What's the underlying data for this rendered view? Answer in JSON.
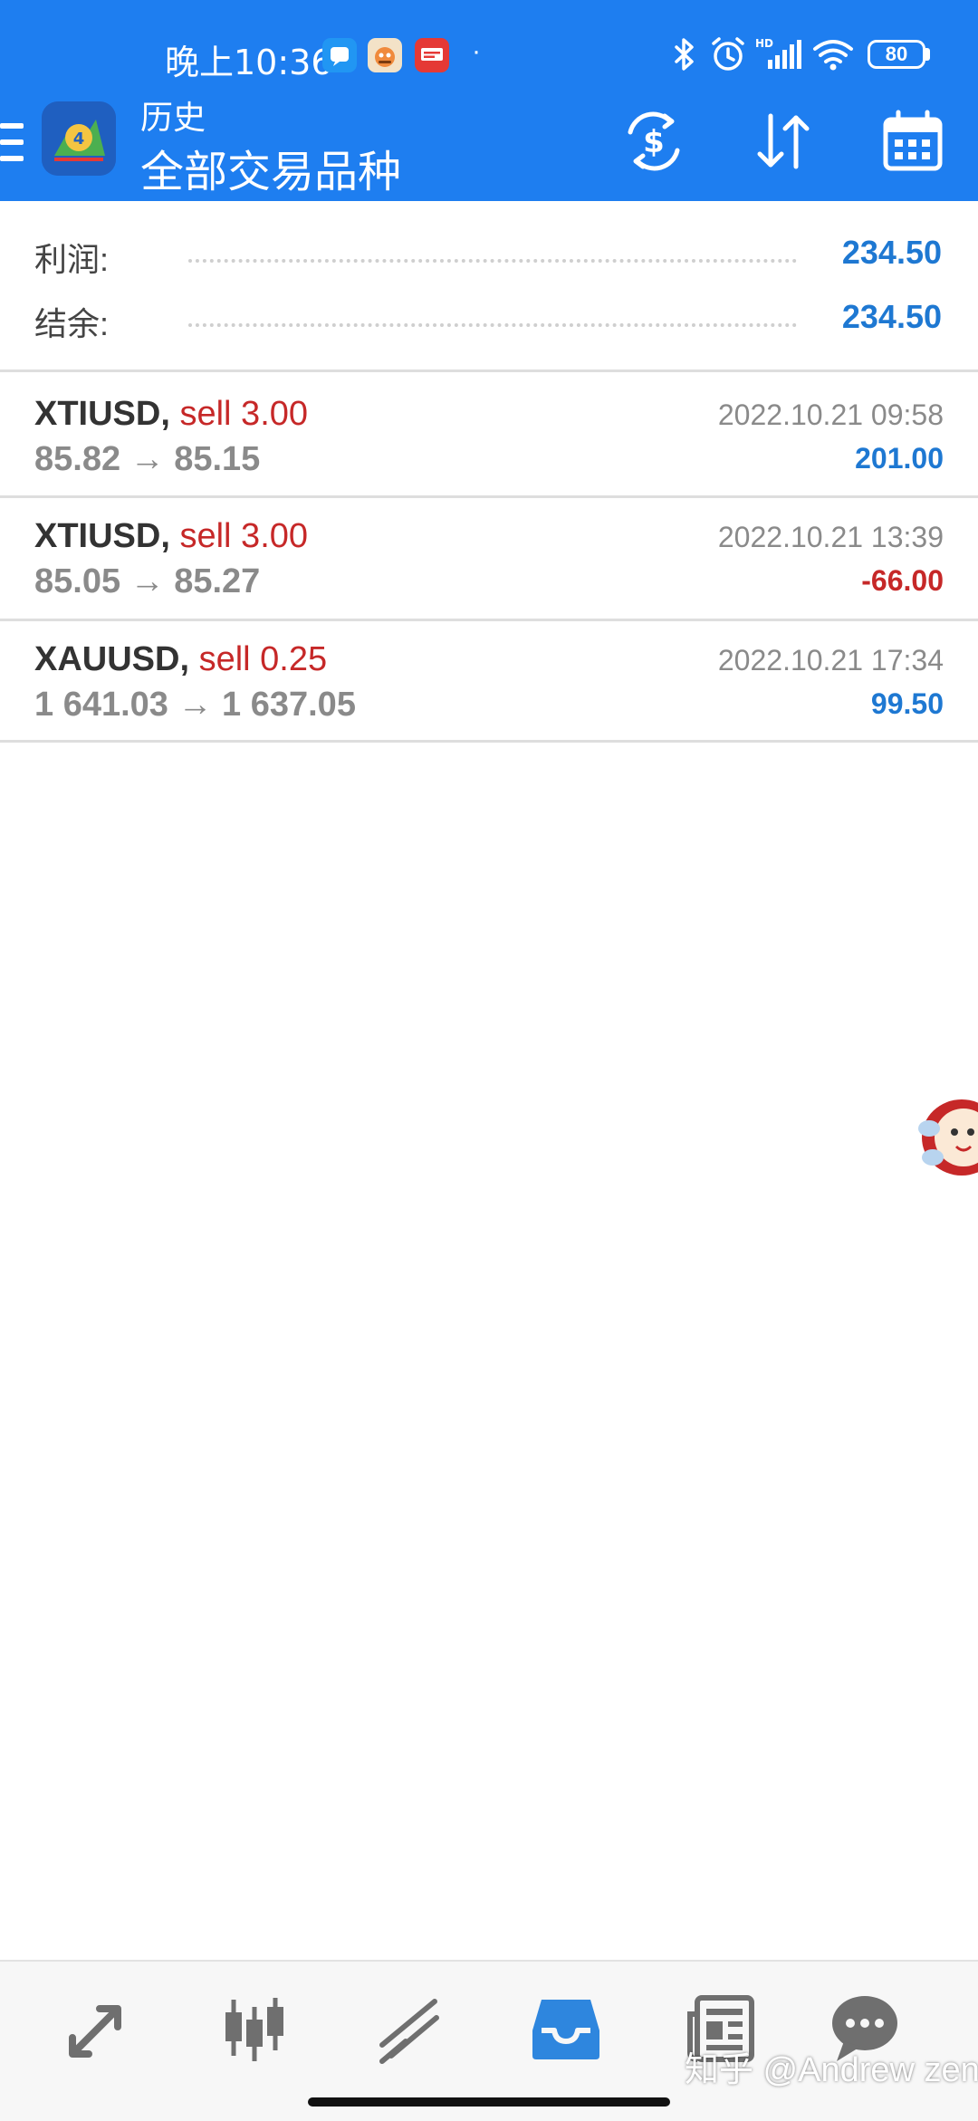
{
  "status_bar": {
    "time": "晚上10:36",
    "dot": "·",
    "battery": "80",
    "icons": [
      "chat-bubble-icon",
      "game-app-icon",
      "news-app-icon",
      "bluetooth-icon",
      "alarm-icon",
      "hd-signal-icon",
      "wifi-icon",
      "battery-icon"
    ]
  },
  "app_bar": {
    "subtitle": "历史",
    "title": "全部交易品种",
    "icons": [
      "menu-icon",
      "app-logo-icon",
      "currency-exchange-icon",
      "sort-icon",
      "calendar-icon"
    ]
  },
  "summary": {
    "profit_label": "利润:",
    "profit_value": "234.50",
    "balance_label": "结余:",
    "balance_value": "234.50"
  },
  "trades": [
    {
      "symbol": "XTIUSD",
      "sep": ",",
      "side": "sell 3.00",
      "prices": "85.82 → 85.15",
      "time": "2022.10.21 09:58",
      "profit": "201.00",
      "profit_color": "#1e78d2"
    },
    {
      "symbol": "XTIUSD",
      "sep": ",",
      "side": "sell 3.00",
      "prices": "85.05 → 85.27",
      "time": "2022.10.21 13:39",
      "profit": "-66.00",
      "profit_color": "#c62828"
    },
    {
      "symbol": "XAUUSD",
      "sep": ",",
      "side": "sell 0.25",
      "prices": "1 641.03 → 1 637.05",
      "time": "2022.10.21 17:34",
      "profit": "99.50",
      "profit_color": "#1e78d2"
    }
  ],
  "bottom_nav": {
    "items": [
      "quotes-icon",
      "chart-candles-icon",
      "trade-icon",
      "history-inbox-icon",
      "news-icon",
      "chat-icon"
    ],
    "active": "history-inbox-icon",
    "watermark": "知乎 @Andrew zeng"
  },
  "colors": {
    "header_bg": "#1e7ef0",
    "positive": "#1e78d2",
    "negative": "#c62828",
    "nav_inactive": "#6f6f6f",
    "nav_active": "#2e86de"
  }
}
